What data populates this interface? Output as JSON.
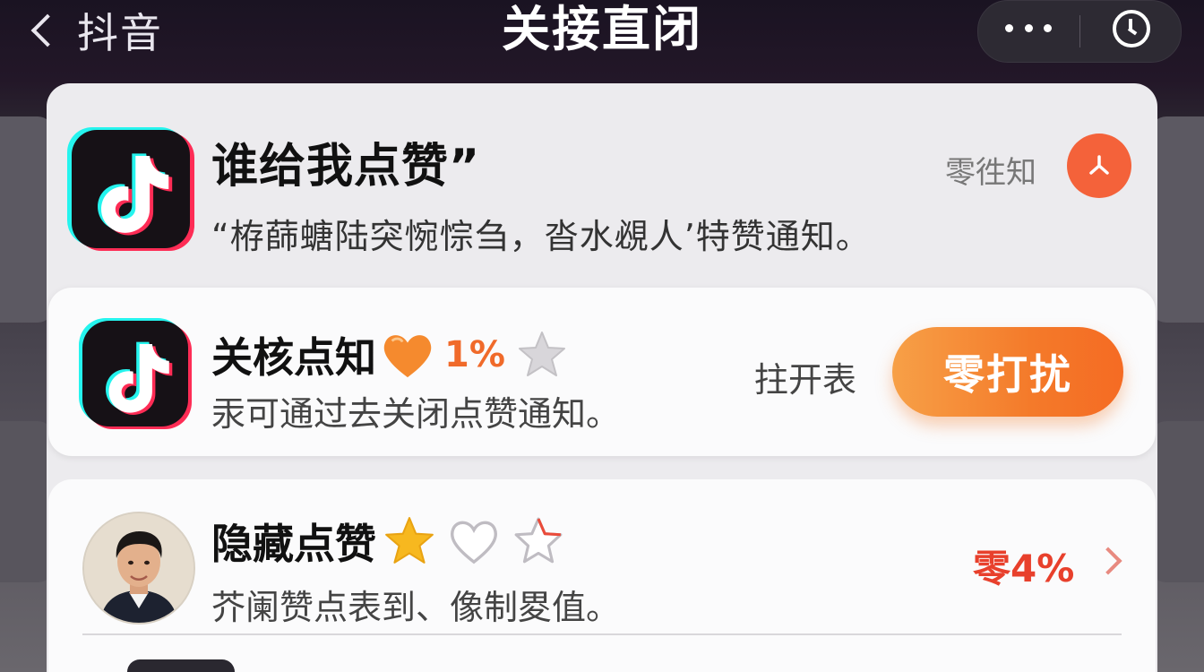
{
  "topbar": {
    "back_label": "抖音",
    "title": "关接直闭",
    "capsule_icons": [
      "more-icon",
      "clock-icon"
    ]
  },
  "header": {
    "title": "谁给我点赞”",
    "subtitle": "“栫蒒螗陆突惋悰刍，沓水覕人’特赞通知。",
    "tag": "零徃知",
    "share_icon": "share-icon"
  },
  "row1": {
    "title": "关核点知",
    "percent": "1%",
    "subtitle": "汞可通过去关闭点赞通知。",
    "open_label": "拄开表",
    "button_label": "零打扰",
    "icons": [
      "heart-icon",
      "star-icon"
    ]
  },
  "row2": {
    "title": "隐藏点赞",
    "subtitle": "芥阑赞点表到、像制畟值。",
    "percent": "零4%",
    "icons": [
      "gold-star-icon",
      "heart-outline-icon",
      "star-outline-icon",
      "chevron-right-icon"
    ]
  },
  "colors": {
    "accent_orange": "#f47a2a",
    "accent_red": "#e8402c",
    "tiktok_cyan": "#25f4ee",
    "tiktok_pink": "#fe2c55"
  }
}
